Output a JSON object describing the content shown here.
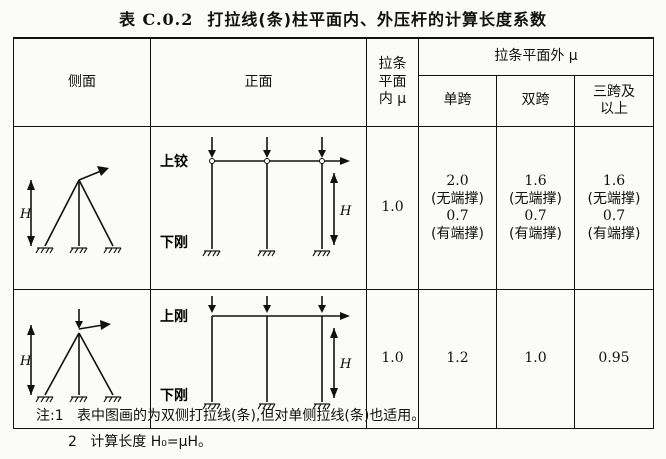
{
  "title": {
    "id": "表 C.0.2",
    "text": "打拉线(条)柱平面内、外压杆的计算长度系数"
  },
  "headers": {
    "side": "侧面",
    "front": "正面",
    "in_plane": [
      "拉条",
      "平面",
      "内 μ"
    ],
    "out_plane": "拉条平面外 μ",
    "single": "单跨",
    "double": "双跨",
    "triple": [
      "三跨及",
      "以上"
    ]
  },
  "rows": [
    {
      "top_label": "上铰",
      "bottom_label": "下刚",
      "h_label": "H",
      "in_plane": "1.0",
      "single": [
        "2.0",
        "(无端撑)",
        "0.7",
        "(有端撑)"
      ],
      "double": [
        "1.6",
        "(无端撑)",
        "0.7",
        "(有端撑)"
      ],
      "triple": [
        "1.6",
        "(无端撑)",
        "0.7",
        "(有端撑)"
      ]
    },
    {
      "top_label": "上刚",
      "bottom_label": "下刚",
      "h_label": "H",
      "in_plane": "1.0",
      "single": "1.2",
      "double": "1.0",
      "triple": "0.95"
    }
  ],
  "notes": {
    "n1_prefix": "注:1",
    "n1_text": "表中图画的为双侧打拉线(条),但对单侧拉线(条)也适用。",
    "n2_prefix": "2",
    "n2_text": "计算长度 H₀=μH。"
  }
}
